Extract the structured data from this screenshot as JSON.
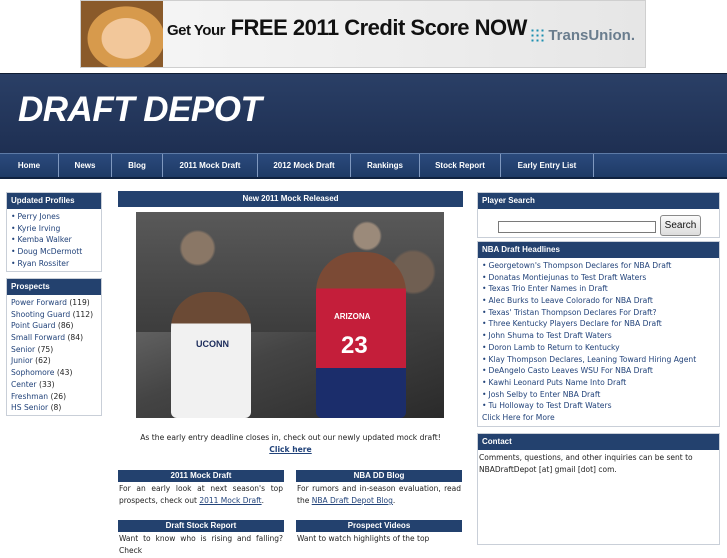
{
  "ad": {
    "prefix": "Get Your",
    "headline": "FREE 2011 Credit Score NOW",
    "brand": "TransUnion."
  },
  "site": {
    "logo": "DRAFT DEPOT"
  },
  "nav": [
    "Home",
    "News",
    "Blog",
    "2011 Mock Draft",
    "2012 Mock Draft",
    "Rankings",
    "Stock Report",
    "Early Entry List"
  ],
  "updated_profiles": {
    "title": "Updated Profiles",
    "items": [
      "Perry Jones",
      "Kyrie Irving",
      "Kemba Walker",
      "Doug McDermott",
      "Ryan Rossiter"
    ]
  },
  "prospects": {
    "title": "Prospects",
    "items": [
      {
        "label": "Power Forward",
        "count": "(119)"
      },
      {
        "label": "Shooting Guard",
        "count": "(112)"
      },
      {
        "label": "Point Guard",
        "count": "(86)"
      },
      {
        "label": "Small Forward",
        "count": "(84)"
      },
      {
        "label": "Senior",
        "count": "(75)"
      },
      {
        "label": "Junior",
        "count": "(62)"
      },
      {
        "label": "Sophomore",
        "count": "(43)"
      },
      {
        "label": "Center",
        "count": "(33)"
      },
      {
        "label": "Freshman",
        "count": "(26)"
      },
      {
        "label": "HS Senior",
        "count": "(8)"
      }
    ]
  },
  "main": {
    "title": "New 2011 Mock Released",
    "photo": {
      "jersey_number": "23",
      "jersey_text": "ARIZONA",
      "opponent_text": "UCONN"
    },
    "caption": "As the early entry deadline closes in, check out our newly updated mock draft!",
    "click_here": "Click here"
  },
  "sub_boxes": {
    "mock": {
      "title": "2011 Mock Draft",
      "text": "For an early look at next season's top prospects, check out",
      "link": "2011 Mock Draft",
      "after": "."
    },
    "blog": {
      "title": "NBA DD Blog",
      "text": "For rumors and in-season evaluation, read the",
      "link": "NBA Draft Depot Blog",
      "after": "."
    },
    "stock": {
      "title": "Draft Stock Report",
      "text": "Want to know who is rising and falling? Check"
    },
    "videos": {
      "title": "Prospect Videos",
      "text": "Want to watch highlights of the top"
    }
  },
  "player_search": {
    "title": "Player Search",
    "button": "Search",
    "placeholder": ""
  },
  "headlines": {
    "title": "NBA Draft Headlines",
    "items": [
      "Georgetown's Thompson Declares for NBA Draft",
      "Donatas Montiejunas to Test Draft Waters",
      "Texas Trio Enter Names in Draft",
      "Alec Burks to Leave Colorado for NBA Draft",
      "Texas' Tristan Thompson Declares For Draft?",
      "Three Kentucky Players Declare for NBA Draft",
      "John Shuma to Test Draft Waters",
      "Doron Lamb to Return to Kentucky",
      "Klay Thompson Declares, Leaning Toward Hiring Agent",
      "DeAngelo Casto Leaves WSU For NBA Draft",
      "Kawhi Leonard Puts Name Into Draft",
      "Josh Selby to Enter NBA Draft",
      "Tu Holloway to Test Draft Waters"
    ],
    "more": "Click Here for More"
  },
  "contact": {
    "title": "Contact",
    "text": "Comments, questions, and other inquiries can be sent to NBADraftDepot [at] gmail [dot] com."
  }
}
